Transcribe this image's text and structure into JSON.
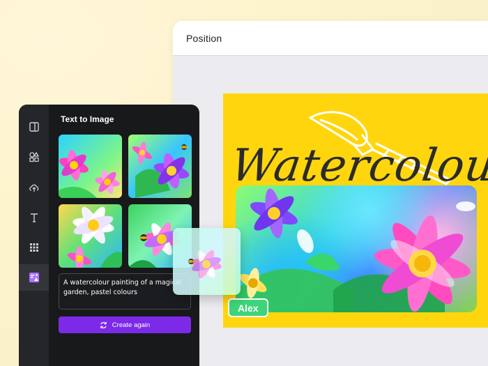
{
  "editor": {
    "title": "Position"
  },
  "design": {
    "headline": "Watercolour",
    "collaborator_tag": "Alex",
    "background_color": "#ffd60e"
  },
  "app_panel": {
    "title": "Text to Image",
    "prompt_text": "A watercolour painting of a magical garden, pastel colours",
    "cta_label": "Create again",
    "cta_icon": "refresh-icon",
    "accent_color": "#7d2ae8",
    "rail_icons": [
      "layout-icon",
      "elements-icon",
      "upload-icon",
      "text-icon",
      "apps-grid-icon",
      "text-to-image-icon"
    ],
    "active_rail_icon": "text-to-image-icon",
    "results_count": 4
  }
}
